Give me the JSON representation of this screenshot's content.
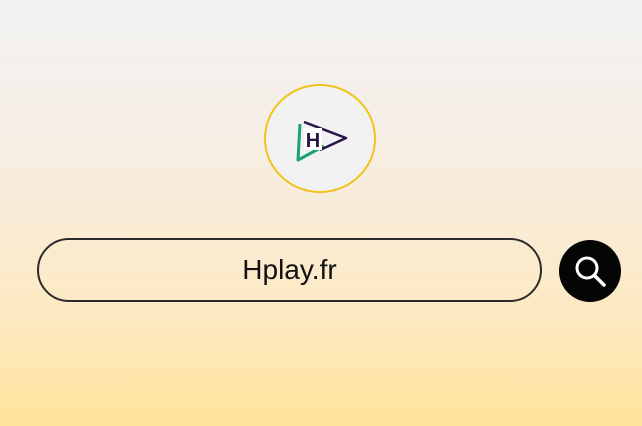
{
  "logo": {
    "icon": "hplay-logo-icon",
    "border_color": "#f2c21f",
    "accent_color": "#1aa37a",
    "dark_color": "#2a1448"
  },
  "search": {
    "value": "Hplay.fr",
    "button_icon": "search-icon",
    "button_color": "#050505"
  }
}
